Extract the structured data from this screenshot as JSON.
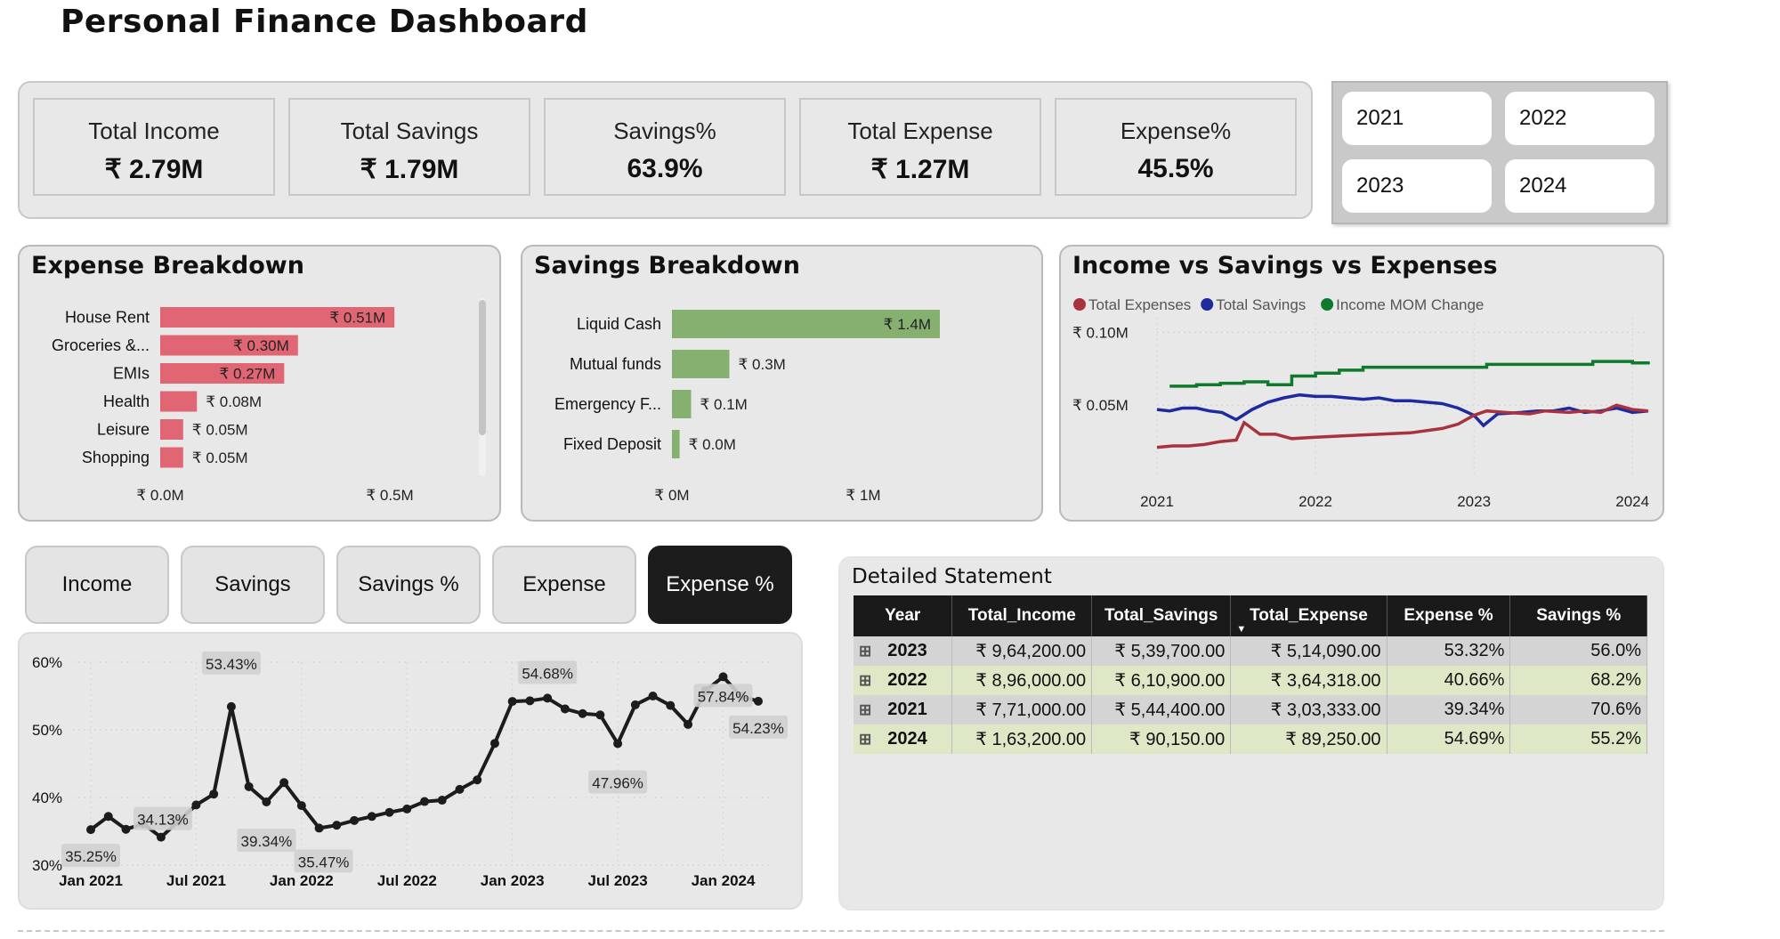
{
  "header": {
    "title": "Personal Finance Dashboard"
  },
  "kpis": [
    {
      "label": "Total Income",
      "value": "₹ 2.79M"
    },
    {
      "label": "Total Savings",
      "value": "₹ 1.79M"
    },
    {
      "label": "Savings%",
      "value": "63.9%"
    },
    {
      "label": "Total Expense",
      "value": "₹ 1.27M"
    },
    {
      "label": "Expense%",
      "value": "45.5%"
    }
  ],
  "year_slicer": [
    "2021",
    "2022",
    "2023",
    "2024"
  ],
  "colors": {
    "expense_bar": "#e06673",
    "savings_bar": "#86b070",
    "red": "#a8323e",
    "blue": "#1f2a9e",
    "green": "#0f7a2e",
    "dark": "#1c1c1c"
  },
  "expense_breakdown": {
    "title": "Expense Breakdown",
    "chart_data": {
      "type": "bar",
      "orientation": "horizontal",
      "categories": [
        "House Rent",
        "Groceries &...",
        "EMIs",
        "Health",
        "Leisure",
        "Shopping"
      ],
      "values": [
        0.51,
        0.3,
        0.27,
        0.08,
        0.05,
        0.05
      ],
      "labels": [
        "₹ 0.51M",
        "₹ 0.30M",
        "₹ 0.27M",
        "₹ 0.08M",
        "₹ 0.05M",
        "₹ 0.05M"
      ],
      "xlim": [
        0,
        0.5
      ],
      "xticks": [
        "₹ 0.0M",
        "₹ 0.5M"
      ]
    }
  },
  "savings_breakdown": {
    "title": "Savings Breakdown",
    "chart_data": {
      "type": "bar",
      "orientation": "horizontal",
      "categories": [
        "Liquid Cash",
        "Mutual funds",
        "Emergency F...",
        "Fixed Deposit"
      ],
      "values": [
        1.4,
        0.3,
        0.1,
        0.04
      ],
      "labels": [
        "₹ 1.4M",
        "₹ 0.3M",
        "₹ 0.1M",
        "₹ 0.0M"
      ],
      "xlim": [
        0,
        1
      ],
      "xticks": [
        "₹ 0M",
        "₹ 1M"
      ]
    }
  },
  "income_vs": {
    "title": "Income vs Savings vs Expenses",
    "chart_data": {
      "type": "line",
      "legend": [
        "Total Expenses",
        "Total Savings",
        "Income MOM Change"
      ],
      "legend_placement": "top-left",
      "y_ticks": [
        "₹ 0.10M",
        "₹ 0.05M"
      ],
      "y_tick_values": [
        0.1,
        0.05
      ],
      "x_ticks": [
        "2021",
        "2022",
        "2023",
        "2024"
      ],
      "x_tick_values": [
        2021,
        2022,
        2023,
        2024
      ],
      "ylim": [
        0.0,
        0.11
      ],
      "xlim": [
        2021,
        2024.1
      ],
      "series": [
        {
          "name": "Income MOM Change",
          "x": [
            2021.08,
            2021.25,
            2021.4,
            2021.55,
            2021.7,
            2021.85,
            2022.0,
            2022.15,
            2022.3,
            2022.5,
            2022.75,
            2023.0,
            2023.08,
            2023.3,
            2023.5,
            2023.75,
            2024.0,
            2024.1
          ],
          "y": [
            0.063,
            0.064,
            0.065,
            0.066,
            0.064,
            0.07,
            0.072,
            0.074,
            0.076,
            0.076,
            0.076,
            0.076,
            0.078,
            0.078,
            0.078,
            0.08,
            0.079,
            0.08
          ]
        },
        {
          "name": "Total Savings",
          "x": [
            2021.0,
            2021.08,
            2021.16,
            2021.25,
            2021.33,
            2021.41,
            2021.5,
            2021.6,
            2021.7,
            2021.8,
            2021.9,
            2022.0,
            2022.1,
            2022.2,
            2022.3,
            2022.4,
            2022.5,
            2022.6,
            2022.7,
            2022.8,
            2022.9,
            2023.0,
            2023.06,
            2023.15,
            2023.3,
            2023.4,
            2023.5,
            2023.6,
            2023.7,
            2023.8,
            2023.9,
            2024.0,
            2024.1
          ],
          "y": [
            0.047,
            0.046,
            0.048,
            0.048,
            0.046,
            0.045,
            0.04,
            0.047,
            0.052,
            0.055,
            0.057,
            0.056,
            0.056,
            0.055,
            0.054,
            0.055,
            0.053,
            0.053,
            0.052,
            0.051,
            0.048,
            0.043,
            0.036,
            0.044,
            0.045,
            0.046,
            0.046,
            0.048,
            0.045,
            0.046,
            0.048,
            0.045,
            0.046
          ]
        },
        {
          "name": "Total Expenses",
          "x": [
            2021.0,
            2021.1,
            2021.2,
            2021.3,
            2021.4,
            2021.5,
            2021.55,
            2021.65,
            2021.75,
            2021.85,
            2022.0,
            2022.2,
            2022.4,
            2022.6,
            2022.8,
            2022.9,
            2023.0,
            2023.08,
            2023.2,
            2023.35,
            2023.45,
            2023.6,
            2023.7,
            2023.8,
            2023.9,
            2024.0,
            2024.1
          ],
          "y": [
            0.021,
            0.022,
            0.022,
            0.023,
            0.025,
            0.026,
            0.038,
            0.03,
            0.03,
            0.027,
            0.028,
            0.029,
            0.03,
            0.031,
            0.034,
            0.037,
            0.043,
            0.046,
            0.045,
            0.044,
            0.046,
            0.045,
            0.046,
            0.045,
            0.05,
            0.047,
            0.046
          ]
        }
      ]
    }
  },
  "metric_buttons": [
    {
      "label": "Income",
      "active": false
    },
    {
      "label": "Savings",
      "active": false
    },
    {
      "label": "Savings %",
      "active": false
    },
    {
      "label": "Expense",
      "active": false
    },
    {
      "label": "Expense %",
      "active": true
    }
  ],
  "trend_chart": {
    "chart_data": {
      "type": "line",
      "ylim": [
        30,
        60
      ],
      "y_ticks": [
        "60%",
        "50%",
        "40%",
        "30%"
      ],
      "y_tick_values": [
        60,
        50,
        40,
        30
      ],
      "x_ticks": [
        "Jan 2021",
        "Jul 2021",
        "Jan 2022",
        "Jul 2022",
        "Jan 2023",
        "Jul 2023",
        "Jan 2024"
      ],
      "x_tick_index": [
        0,
        6,
        12,
        18,
        24,
        30,
        36
      ],
      "values": [
        35.25,
        37.2,
        35.3,
        36.1,
        34.13,
        36.5,
        38.9,
        40.5,
        53.43,
        41.6,
        39.34,
        42.2,
        38.8,
        35.47,
        35.9,
        36.6,
        37.2,
        37.8,
        38.3,
        39.4,
        39.6,
        41.2,
        42.6,
        48.0,
        54.2,
        54.3,
        54.68,
        53.1,
        52.4,
        52.2,
        47.96,
        53.7,
        55.0,
        53.6,
        50.8,
        55.8,
        57.84,
        55.0,
        54.23
      ],
      "data_labels": [
        {
          "index": 0,
          "text": "35.25%"
        },
        {
          "index": 4,
          "text": "34.13%"
        },
        {
          "index": 8,
          "text": "53.43%"
        },
        {
          "index": 10,
          "text": "39.34%"
        },
        {
          "index": 13,
          "text": "35.47%"
        },
        {
          "index": 26,
          "text": "54.68%"
        },
        {
          "index": 30,
          "text": "47.96%"
        },
        {
          "index": 36,
          "text": "57.84%"
        },
        {
          "index": 38,
          "text": "54.23%"
        }
      ]
    }
  },
  "statement": {
    "title": "Detailed Statement",
    "columns": [
      "Year",
      "Total_Income",
      "Total_Savings",
      "Total_Expense",
      "Expense %",
      "Savings %"
    ],
    "rows": [
      [
        "2023",
        "₹ 9,64,200.00",
        "₹ 5,39,700.00",
        "₹ 5,14,090.00",
        "53.32%",
        "56.0%"
      ],
      [
        "2022",
        "₹ 8,96,000.00",
        "₹ 6,10,900.00",
        "₹ 3,64,318.00",
        "40.66%",
        "68.2%"
      ],
      [
        "2021",
        "₹ 7,71,000.00",
        "₹ 5,44,400.00",
        "₹ 3,03,333.00",
        "39.34%",
        "70.6%"
      ],
      [
        "2024",
        "₹ 1,63,200.00",
        "₹ 90,150.00",
        "₹ 89,250.00",
        "54.69%",
        "55.2%"
      ]
    ]
  }
}
